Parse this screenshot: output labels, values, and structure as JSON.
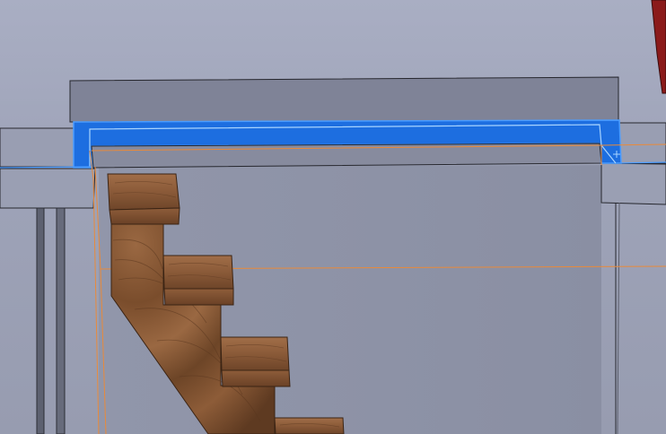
{
  "viewport": {
    "background_top": "#a9aec3",
    "background_bottom": "#979cb0"
  },
  "model": {
    "header_beam": {
      "face_color": "#7e8296",
      "top_color": "#8a8ea2",
      "underside_color": "#878b9e",
      "selected": true,
      "selection_color": "#1d6ee0",
      "selection_highlight": "#4a9cff"
    },
    "side_walls": {
      "color": "#9599ab",
      "edge_color": "#1f2026"
    },
    "background_wall": {
      "color": "#8c91a5"
    },
    "stair": {
      "material": "wood",
      "tread_color": "#8a5a38",
      "tread_highlight": "#a16e48",
      "tread_dark": "#5a371f",
      "stringer_color": "#6d4527",
      "stringer_light": "#9a6842",
      "visible_treads": 4
    },
    "railing_posts": {
      "color": "#5d6170",
      "count": 2
    },
    "sketch_lines": {
      "color": "#e98a3a"
    },
    "corner_object": {
      "color": "#8b1a1a"
    },
    "cursor": {
      "icon": "plus-cursor-icon",
      "color": "#a8d4ff"
    }
  }
}
